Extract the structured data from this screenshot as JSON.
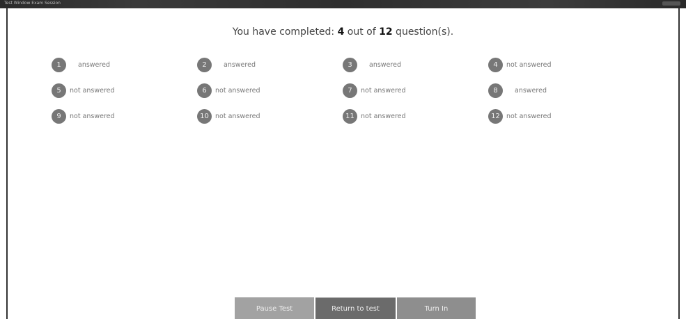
{
  "window": {
    "title": "Test Window Exam Session"
  },
  "summary": {
    "prefix": "You have completed: ",
    "completed": "4",
    "middle": " out of ",
    "total": "12",
    "suffix": " question(s)."
  },
  "questions": [
    {
      "number": "1",
      "status": "answered"
    },
    {
      "number": "2",
      "status": "answered"
    },
    {
      "number": "3",
      "status": "answered"
    },
    {
      "number": "4",
      "status": "not answered"
    },
    {
      "number": "5",
      "status": "not answered"
    },
    {
      "number": "6",
      "status": "not answered"
    },
    {
      "number": "7",
      "status": "not answered"
    },
    {
      "number": "8",
      "status": "answered"
    },
    {
      "number": "9",
      "status": "not answered"
    },
    {
      "number": "10",
      "status": "not answered"
    },
    {
      "number": "11",
      "status": "not answered"
    },
    {
      "number": "12",
      "status": "not answered"
    }
  ],
  "buttons": {
    "pause": "Pause Test",
    "return": "Return to test",
    "turn_in": "Turn In"
  },
  "colors": {
    "badge": "#777777",
    "pause_button": "#a2a2a2",
    "return_button": "#6b6b6b",
    "turn_in_button": "#8e8e8e"
  }
}
